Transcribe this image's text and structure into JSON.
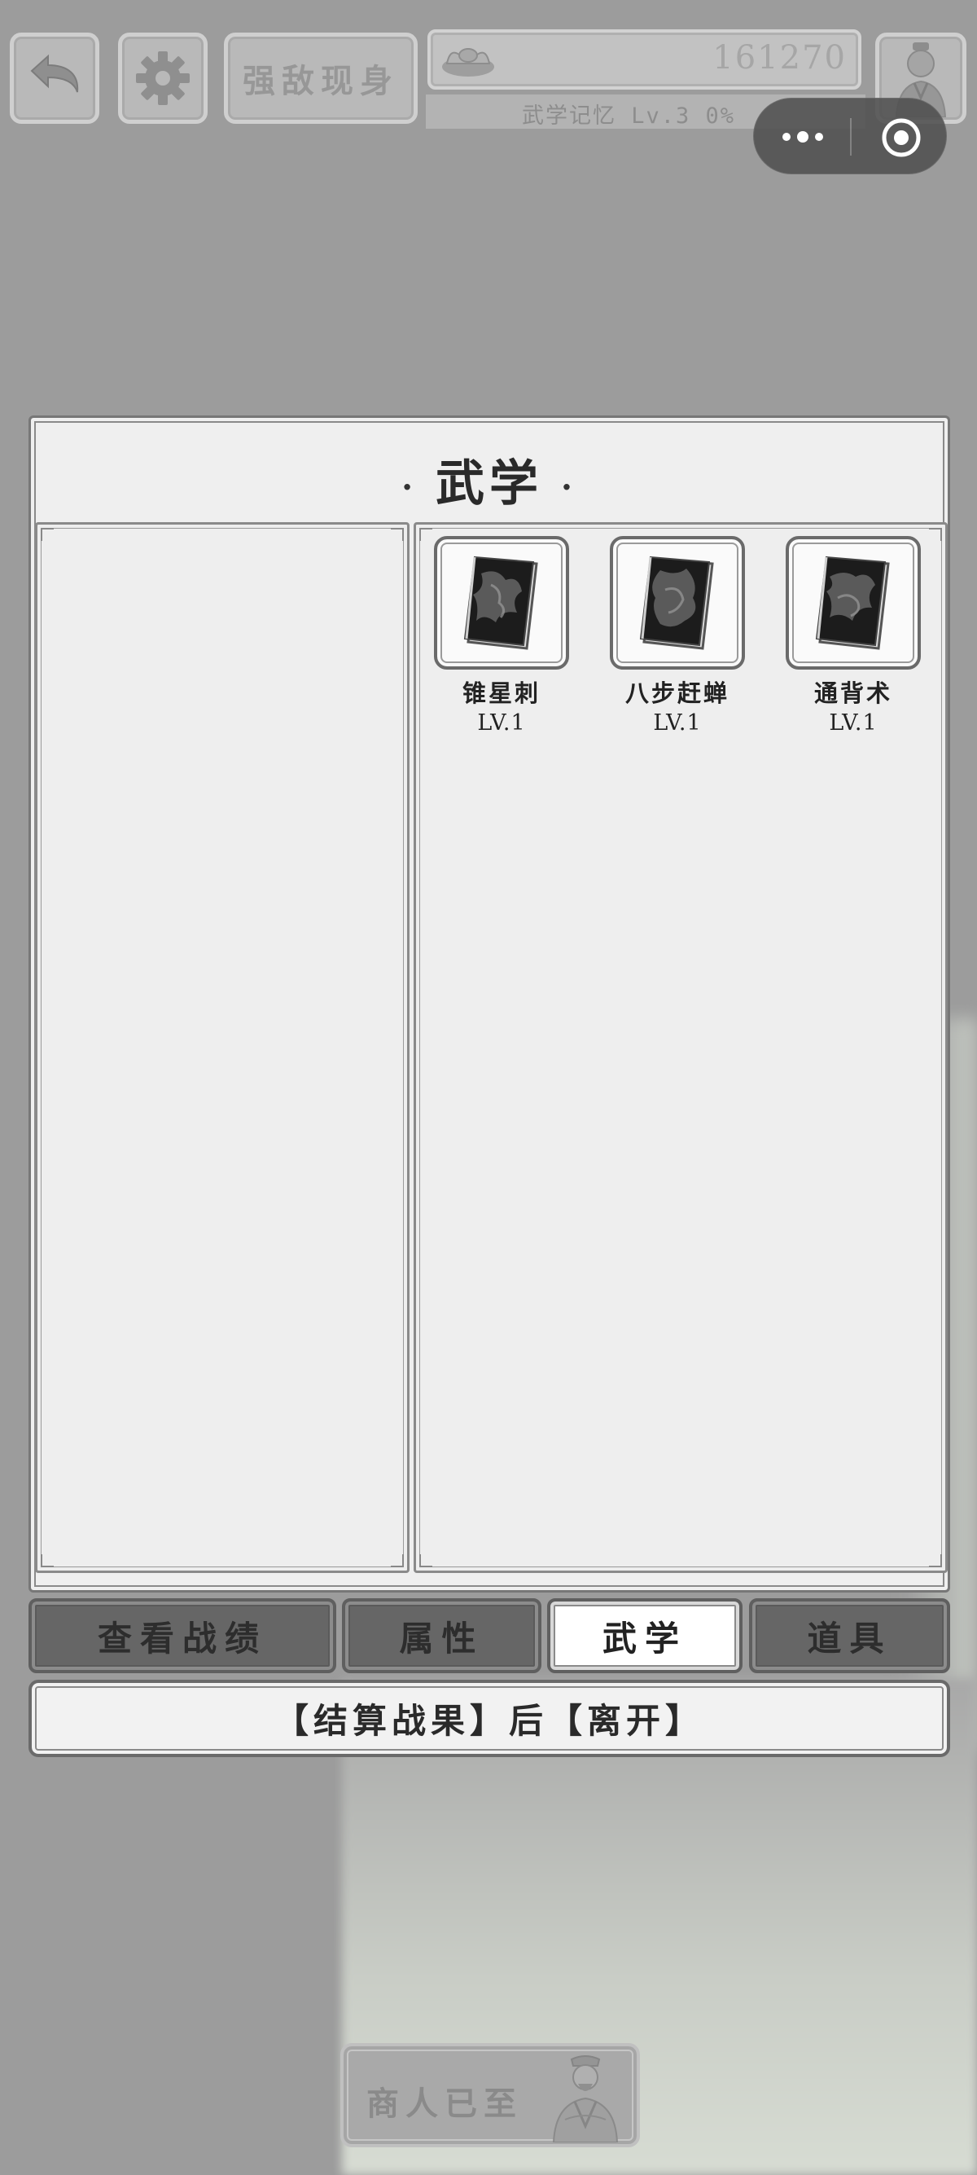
{
  "top_bar": {
    "enemy_label": "强敌现身",
    "gold_value": "161270",
    "memory_text": "武学记忆 Lv.3 0%"
  },
  "panel": {
    "title": "武学",
    "skills": [
      {
        "name": "锥星刺",
        "level": "LV.1"
      },
      {
        "name": "八步赶蝉",
        "level": "LV.1"
      },
      {
        "name": "通背术",
        "level": "LV.1"
      }
    ]
  },
  "tabs": {
    "record": "查看战绩",
    "attributes": "属性",
    "martial": "武学",
    "items": "道具",
    "active": "martial"
  },
  "settle_button": "【结算战果】后【离开】",
  "merchant_label": "商人已至",
  "icons": {
    "back": "back-arrow-icon",
    "settings": "gear-icon",
    "gold": "gold-ingot-icon",
    "avatar": "character-portrait-icon",
    "capsule_more": "more-dots-icon",
    "capsule_close": "target-close-icon",
    "skill_book": "martial-book-icon",
    "merchant": "merchant-portrait-icon"
  },
  "colors": {
    "background": "#9c9c9c",
    "panel": "#efefef",
    "tab_inactive": "#666666",
    "tab_active": "#ffffff"
  }
}
